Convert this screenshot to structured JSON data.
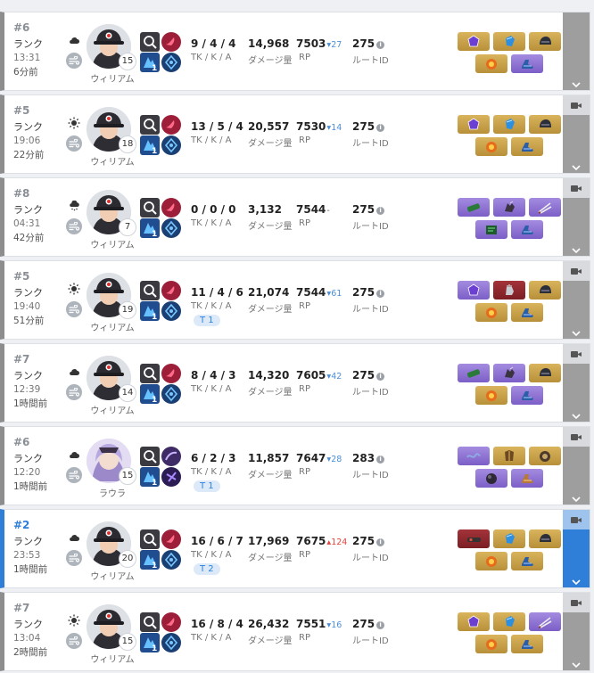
{
  "labels": {
    "kda": "TK / K / A",
    "damage": "ダメージ量",
    "rp": "RP",
    "route": "ルートID"
  },
  "matches": [
    {
      "rank": "#6",
      "mode": "ランク",
      "time": "13:31",
      "ago": "6分前",
      "character": "ウィリアム",
      "level": "15",
      "kda": "9 / 4 / 4",
      "team": "",
      "damage": "14,968",
      "rp": "7503",
      "rp_change": "27",
      "rp_dir": "down",
      "route": "275",
      "weather": "cloudy",
      "items": [
        "purple-gem",
        "blue-gauntlet",
        "dark-helmet",
        "orange-charm",
        "blue-boots"
      ],
      "item_colors": [
        "gold",
        "gold",
        "gold",
        "gold",
        "purple"
      ],
      "highlight": false,
      "video": false
    },
    {
      "rank": "#5",
      "mode": "ランク",
      "time": "19:06",
      "ago": "22分前",
      "character": "ウィリアム",
      "level": "18",
      "kda": "13 / 5 / 4",
      "team": "",
      "damage": "20,557",
      "rp": "7530",
      "rp_change": "14",
      "rp_dir": "down",
      "route": "275",
      "weather": "sunny",
      "items": [
        "purple-gem",
        "blue-gauntlet",
        "dark-helmet",
        "orange-charm",
        "blue-boots"
      ],
      "item_colors": [
        "gold",
        "gold",
        "gold",
        "gold",
        "gold"
      ],
      "highlight": false,
      "video": true
    },
    {
      "rank": "#8",
      "mode": "ランク",
      "time": "04:31",
      "ago": "42分前",
      "character": "ウィリアム",
      "level": "7",
      "kda": "0 / 0 / 0",
      "team": "",
      "damage": "3,132",
      "rp": "7544",
      "rp_change": "-",
      "rp_dir": "flat",
      "route": "275",
      "weather": "snowy",
      "items": [
        "green-cannon",
        "claw-glove",
        "twin-swords",
        "green-circuit",
        "blue-boots"
      ],
      "item_colors": [
        "purple",
        "purple",
        "purple",
        "purple",
        "purple"
      ],
      "highlight": false,
      "video": true
    },
    {
      "rank": "#5",
      "mode": "ランク",
      "time": "19:40",
      "ago": "51分前",
      "character": "ウィリアム",
      "level": "19",
      "kda": "11 / 4 / 6",
      "team": "T 1",
      "damage": "21,074",
      "rp": "7544",
      "rp_change": "61",
      "rp_dir": "down",
      "route": "275",
      "weather": "sunny",
      "items": [
        "purple-gem",
        "silver-glove",
        "dark-helmet",
        "orange-charm",
        "blue-boots"
      ],
      "item_colors": [
        "purple",
        "red",
        "gold",
        "gold",
        "gold"
      ],
      "highlight": false,
      "video": true
    },
    {
      "rank": "#7",
      "mode": "ランク",
      "time": "12:39",
      "ago": "1時間前",
      "character": "ウィリアム",
      "level": "14",
      "kda": "8 / 4 / 3",
      "team": "",
      "damage": "14,320",
      "rp": "7605",
      "rp_change": "42",
      "rp_dir": "down",
      "route": "275",
      "weather": "cloudy",
      "items": [
        "green-cannon",
        "claw-glove",
        "dark-helmet",
        "orange-charm",
        "blue-boots"
      ],
      "item_colors": [
        "purple",
        "purple",
        "gold",
        "gold",
        "purple"
      ],
      "highlight": false,
      "video": true
    },
    {
      "rank": "#6",
      "mode": "ランク",
      "time": "12:20",
      "ago": "1時間前",
      "character": "ラウラ",
      "level": "15",
      "kda": "6 / 2 / 3",
      "team": "T 1",
      "damage": "11,857",
      "rp": "7647",
      "rp_change": "28",
      "rp_dir": "down",
      "route": "283",
      "weather": "cloudy",
      "items": [
        "chain-whip",
        "bronze-armor",
        "round-shield",
        "dark-orb",
        "gold-boots"
      ],
      "item_colors": [
        "purple",
        "gold",
        "gold",
        "purple",
        "purple"
      ],
      "highlight": false,
      "video": true
    },
    {
      "rank": "#2",
      "mode": "ランク",
      "time": "23:53",
      "ago": "1時間前",
      "character": "ウィリアム",
      "level": "20",
      "kda": "16 / 6 / 7",
      "team": "T 2",
      "damage": "17,969",
      "rp": "7675",
      "rp_change": "124",
      "rp_dir": "up",
      "route": "275",
      "weather": "cloudy",
      "items": [
        "red-launcher",
        "blue-gauntlet",
        "dark-helmet",
        "orange-charm",
        "blue-boots"
      ],
      "item_colors": [
        "red",
        "gold",
        "gold",
        "gold",
        "gold"
      ],
      "highlight": true,
      "video": true
    },
    {
      "rank": "#7",
      "mode": "ランク",
      "time": "13:04",
      "ago": "2時間前",
      "character": "ウィリアム",
      "level": "15",
      "kda": "16 / 8 / 4",
      "team": "",
      "damage": "26,432",
      "rp": "7551",
      "rp_change": "16",
      "rp_dir": "down",
      "route": "275",
      "weather": "sunny",
      "items": [
        "purple-gem",
        "blue-gauntlet",
        "twin-swords",
        "orange-charm",
        "blue-boots"
      ],
      "item_colors": [
        "gold",
        "gold",
        "purple",
        "gold",
        "gold"
      ],
      "highlight": false,
      "video": true
    }
  ]
}
